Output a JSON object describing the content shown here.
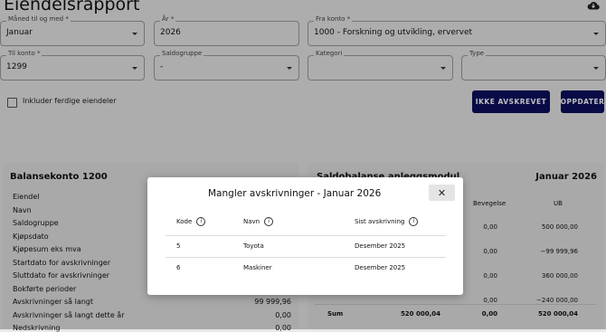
{
  "header": {
    "title": "Eiendelsrapport"
  },
  "filters": {
    "month": {
      "label": "Måned til og med *",
      "value": "Januar"
    },
    "year": {
      "label": "År *",
      "value": "2026"
    },
    "from_account": {
      "label": "Fra konto *",
      "value": "1000 - Forskning og utvikling, ervervet"
    },
    "to_account": {
      "label": "Til konto *",
      "value": "1299"
    },
    "balance_group": {
      "label": "Saldogruppe",
      "value": "-"
    },
    "category": {
      "label": "Kategori",
      "value": ""
    },
    "type": {
      "label": "Type",
      "value": ""
    }
  },
  "checkbox": {
    "label": "Inkluder ferdige eiendeler",
    "checked": false
  },
  "buttons": {
    "not_depreciated": "IKKE AVSKREVET",
    "update": "OPPDATER"
  },
  "left_panel": {
    "title": "Balansekonto 1200",
    "rows": [
      {
        "label": "Eiendel",
        "value": ""
      },
      {
        "label": "Navn",
        "value": ""
      },
      {
        "label": "Saldogruppe",
        "value": ""
      },
      {
        "label": "Kjøpsdato",
        "value": ""
      },
      {
        "label": "Kjøpesum eks mva",
        "value": ""
      },
      {
        "label": "Startdato for avskrivninger",
        "value": ""
      },
      {
        "label": "Sluttdato for avskrivninger",
        "value": ""
      },
      {
        "label": "Bokførte perioder",
        "value": ""
      },
      {
        "label": "Avskrivninger så langt",
        "value": "99 999,96"
      },
      {
        "label": "Avskrivninger så langt dette år",
        "value": "0,00"
      },
      {
        "label": "Nedskrivning",
        "value": "0,00"
      }
    ]
  },
  "right_panel": {
    "title": "Saldobalanse anleggsmodul",
    "period": "Januar 2026",
    "columns": [
      "Bevegelse",
      "UB"
    ],
    "rows": [
      {
        "movement": "0,00",
        "ub": "500 000,00"
      },
      {
        "movement": "0,00",
        "ub": "−99 999,96"
      },
      {
        "movement": "0,00",
        "ub": "360 000,00"
      },
      {
        "movement": "0,00",
        "ub": "−240 000,00"
      }
    ],
    "sum": {
      "label": "Sum",
      "first": "520 000,04",
      "movement": "0,00",
      "ub": "520 000,04"
    }
  },
  "modal": {
    "title": "Mangler avskrivninger - Januar 2026",
    "close_icon": "close-icon",
    "columns": [
      "Kode",
      "Navn",
      "Sist avskrivning"
    ],
    "rows": [
      {
        "code": "5",
        "name": "Toyota",
        "last": "Desember 2025"
      },
      {
        "code": "6",
        "name": "Maskiner",
        "last": "Desember 2025"
      }
    ]
  },
  "icons": {
    "download": "cloud-download-icon",
    "info": "info-icon",
    "dropdown": "chevron-down-icon"
  },
  "colors": {
    "primary_button": "#0b0f5e",
    "backdrop": "#e7e7e7"
  }
}
